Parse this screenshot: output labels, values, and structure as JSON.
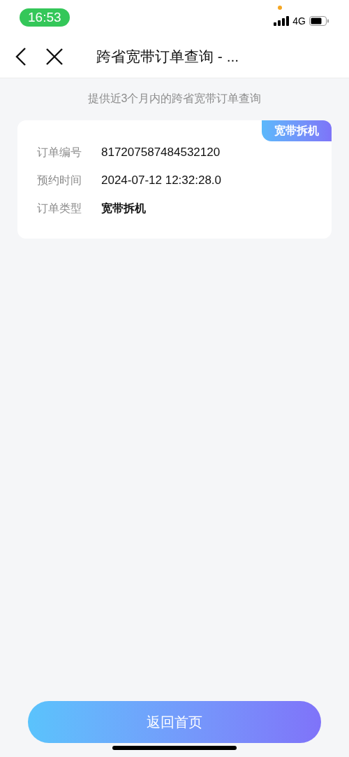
{
  "status_bar": {
    "time": "16:53",
    "network": "4G"
  },
  "nav": {
    "title": "跨省宽带订单查询 - ..."
  },
  "subtitle": "提供近3个月内的跨省宽带订单查询",
  "order": {
    "tag": "宽带拆机",
    "fields": [
      {
        "label": "订单编号",
        "value": "817207587484532120",
        "kind": "number"
      },
      {
        "label": "预约时间",
        "value": "2024-07-12 12:32:28.0",
        "kind": "number"
      },
      {
        "label": "订单类型",
        "value": "宽带拆机",
        "kind": "text"
      }
    ]
  },
  "home_button": "返回首页"
}
